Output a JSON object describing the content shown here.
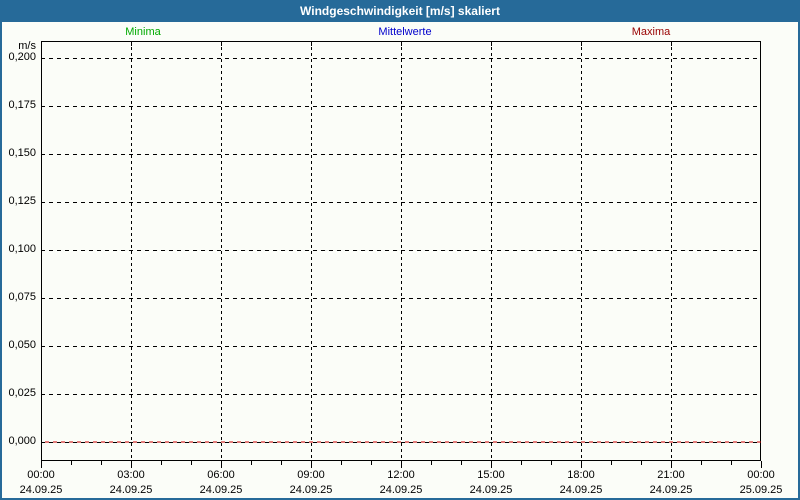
{
  "window": {
    "title": "Windgeschwindigkeit [m/s] skaliert"
  },
  "colors": {
    "titlebar_bg": "#266a99",
    "title_text": "#ffffff",
    "frame_border": "#266a99",
    "background": "#fbfdf8",
    "grid": "#000000",
    "minima": "#00aa00",
    "mittelwerte": "#0000cc",
    "maxima": "#990000",
    "zero_line_red": "#cc0000"
  },
  "legend": {
    "items": [
      {
        "label": "Minima",
        "color": "#00aa00"
      },
      {
        "label": "Mittelwerte",
        "color": "#0000cc"
      },
      {
        "label": "Maxima",
        "color": "#990000"
      }
    ]
  },
  "chart_data": {
    "type": "line",
    "title": "Windgeschwindigkeit [m/s] skaliert",
    "xlabel": "",
    "ylabel": "m/s",
    "ylim": [
      0,
      0.2
    ],
    "ytick_step": 0.025,
    "yticks": [
      {
        "value": 0.0,
        "label": "0,000"
      },
      {
        "value": 0.025,
        "label": "0,025"
      },
      {
        "value": 0.05,
        "label": "0,050"
      },
      {
        "value": 0.075,
        "label": "0,075"
      },
      {
        "value": 0.1,
        "label": "0,100"
      },
      {
        "value": 0.125,
        "label": "0,125"
      },
      {
        "value": 0.15,
        "label": "0,150"
      },
      {
        "value": 0.175,
        "label": "0,175"
      },
      {
        "value": 0.2,
        "label": "0,200"
      }
    ],
    "x_hours": [
      0,
      3,
      6,
      9,
      12,
      15,
      18,
      21,
      24
    ],
    "xticks": [
      {
        "time": "00:00",
        "date": "24.09.25"
      },
      {
        "time": "03:00",
        "date": "24.09.25"
      },
      {
        "time": "06:00",
        "date": "24.09.25"
      },
      {
        "time": "09:00",
        "date": "24.09.25"
      },
      {
        "time": "12:00",
        "date": "24.09.25"
      },
      {
        "time": "15:00",
        "date": "24.09.25"
      },
      {
        "time": "18:00",
        "date": "24.09.25"
      },
      {
        "time": "21:00",
        "date": "24.09.25"
      },
      {
        "time": "00:00",
        "date": "25.09.25"
      }
    ],
    "minor_tick_interval_hours": 1,
    "grid": true,
    "legend_position": "top",
    "series": [
      {
        "name": "Minima",
        "color": "#00aa00",
        "values": [
          0,
          0,
          0,
          0,
          0,
          0,
          0,
          0,
          0
        ]
      },
      {
        "name": "Mittelwerte",
        "color": "#0000cc",
        "values": [
          0,
          0,
          0,
          0,
          0,
          0,
          0,
          0,
          0
        ]
      },
      {
        "name": "Maxima",
        "color": "#cc0000",
        "values": [
          0,
          0,
          0,
          0,
          0,
          0,
          0,
          0,
          0
        ]
      }
    ]
  }
}
